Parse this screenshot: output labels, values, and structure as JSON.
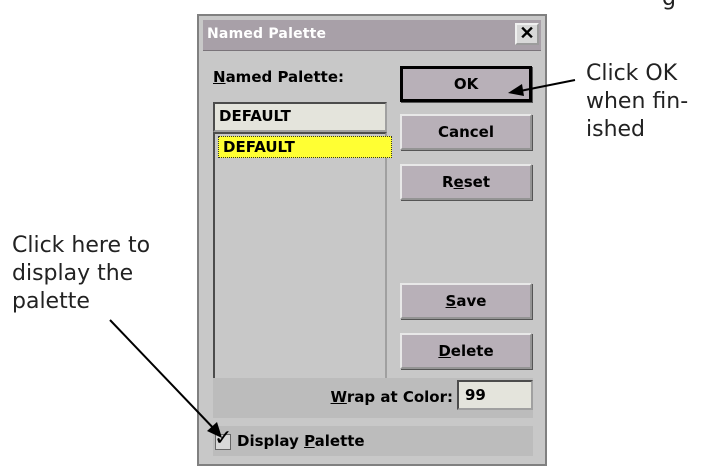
{
  "top_fragment": "g",
  "dialog": {
    "title": "Named Palette",
    "close_glyph": "✕",
    "named_palette_label_prefix": "N",
    "named_palette_label_rest": "amed Palette:",
    "selected_value": "DEFAULT",
    "list_items": [
      "DEFAULT"
    ],
    "buttons": {
      "ok": "OK",
      "cancel": "Cancel",
      "reset_pre": "R",
      "reset_u": "e",
      "reset_post": "set",
      "save_u": "S",
      "save_post": "ave",
      "delete_u": "D",
      "delete_post": "elete"
    },
    "wrap_label_u": "W",
    "wrap_label_rest": "rap at Color:",
    "wrap_value": "99",
    "display_checked": true,
    "display_label_pre": "Display ",
    "display_label_u": "P",
    "display_label_post": "alette"
  },
  "annotations": {
    "ok_lines": [
      "Click OK",
      "when fin-",
      "ished"
    ],
    "display_lines": [
      "Click here to",
      "display the",
      "palette"
    ]
  }
}
